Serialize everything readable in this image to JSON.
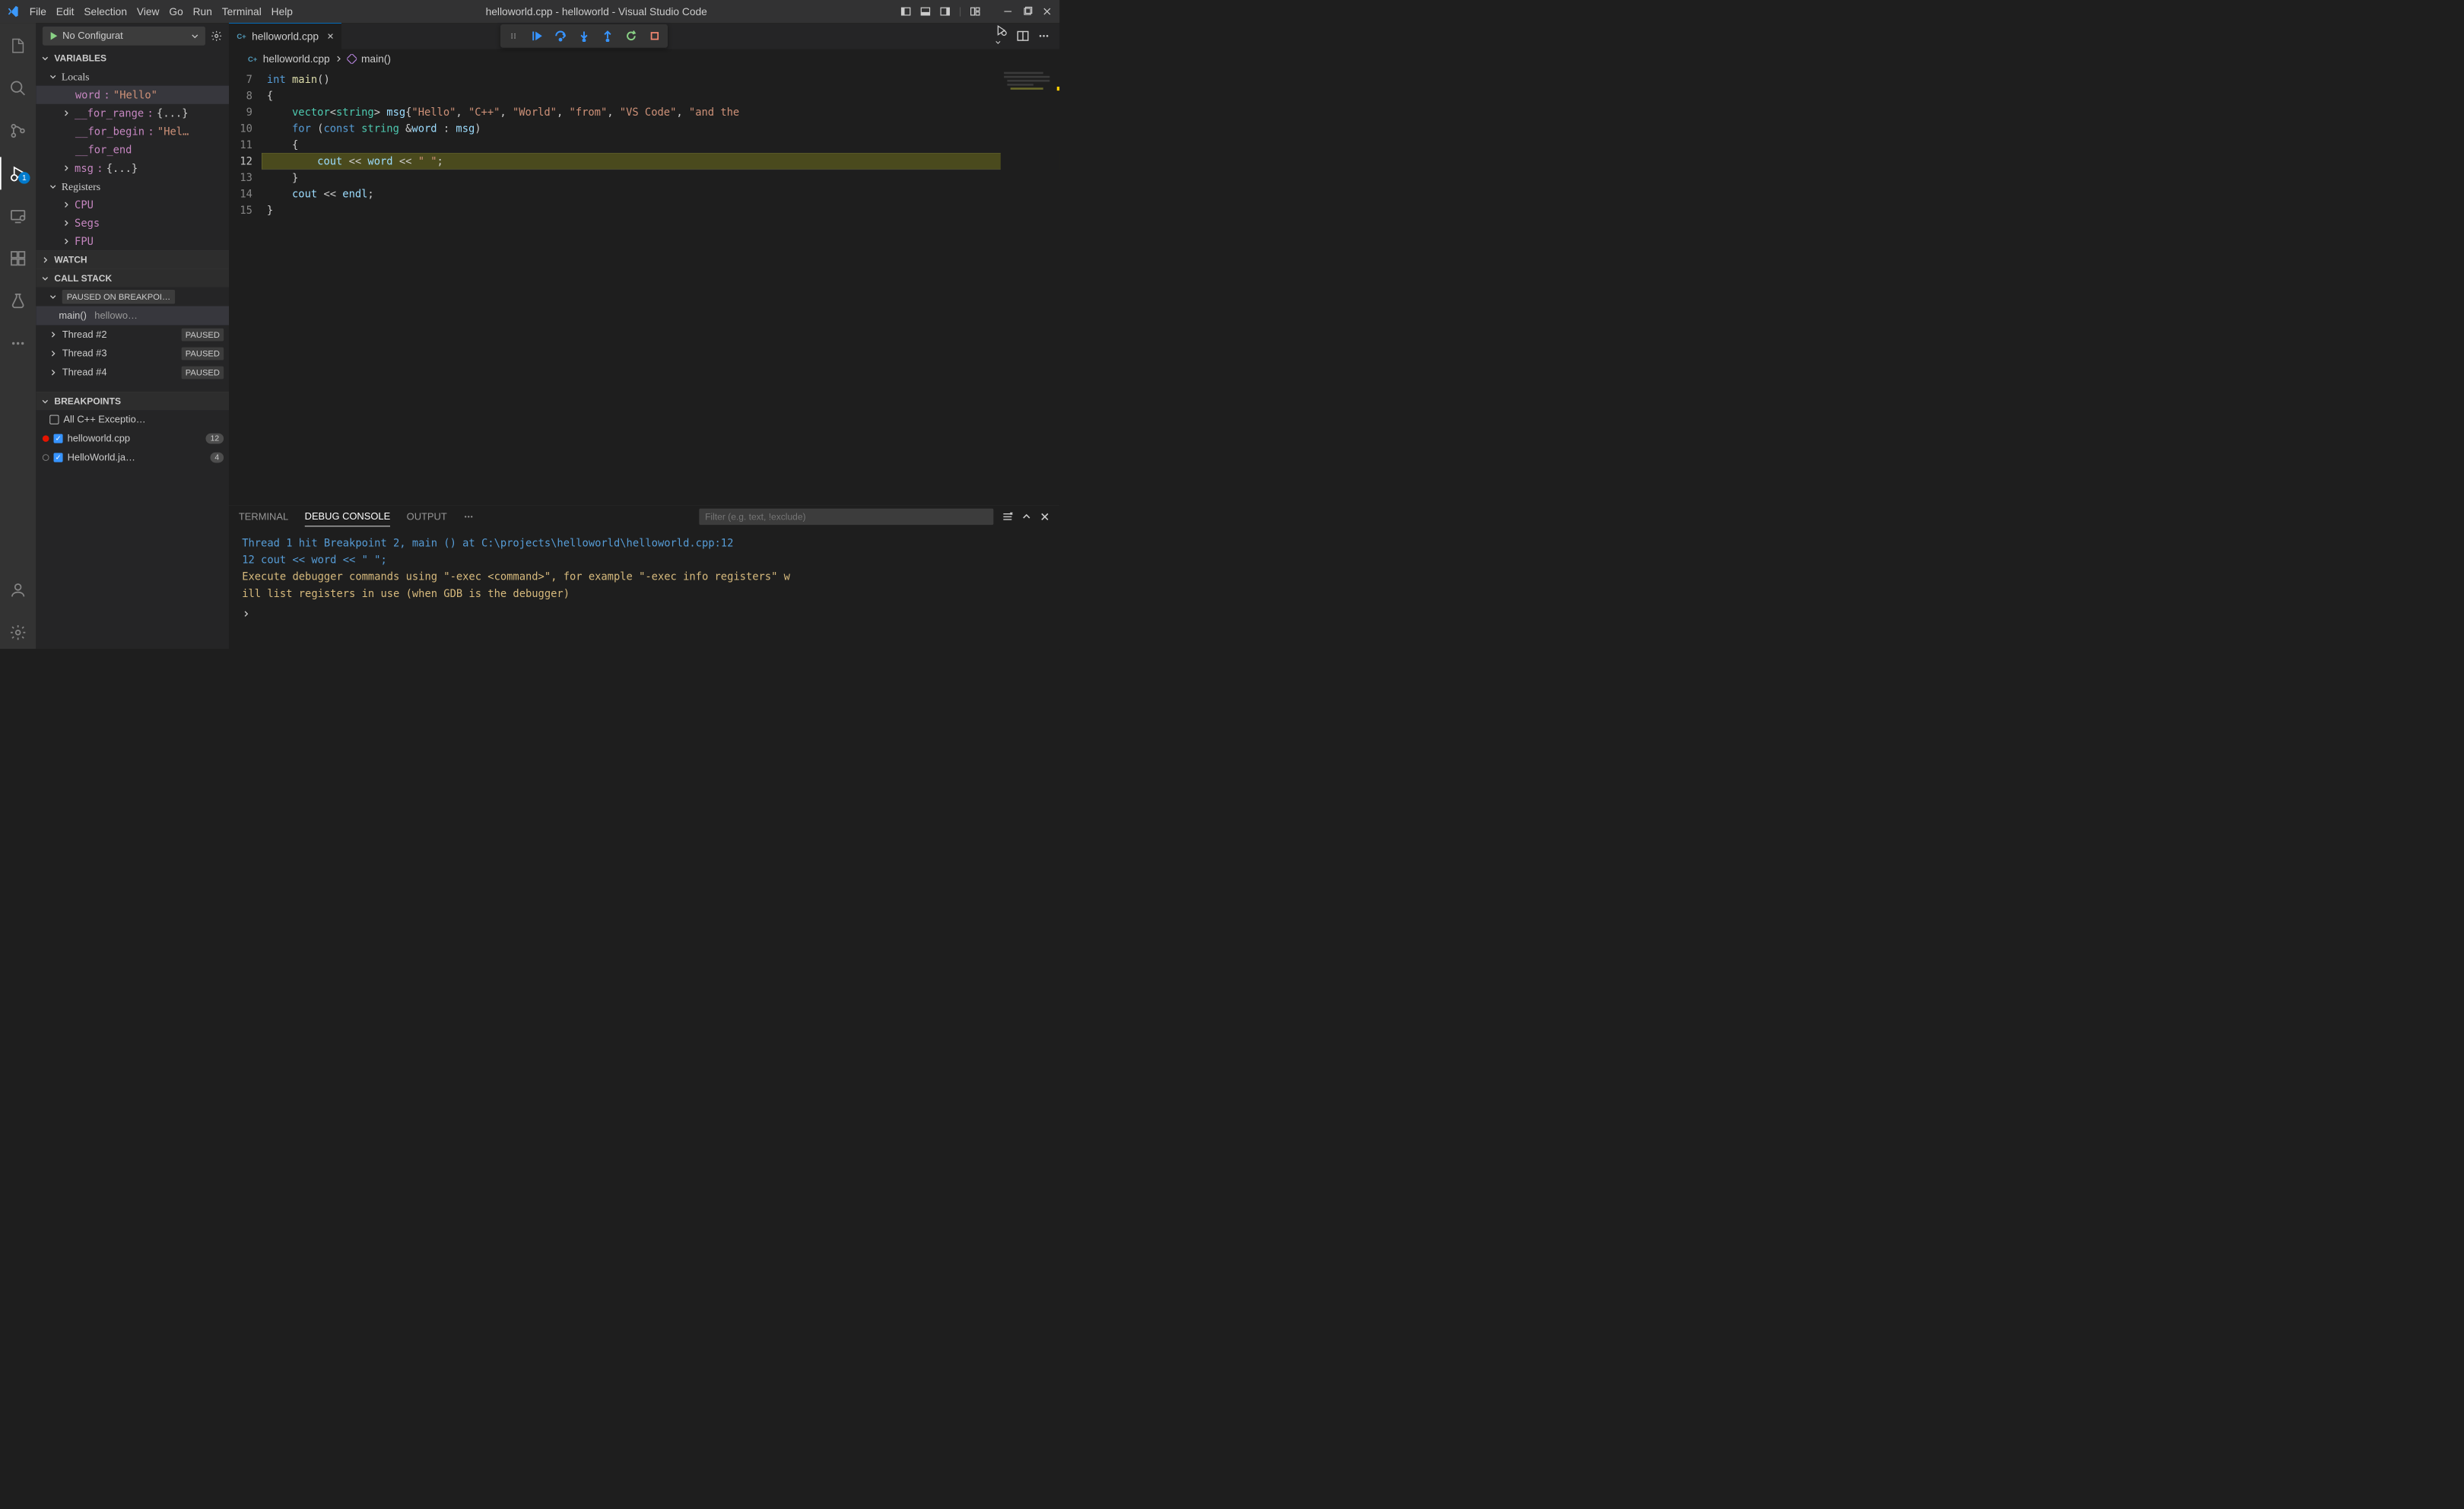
{
  "title": "helloworld.cpp - helloworld - Visual Studio Code",
  "menu": [
    "File",
    "Edit",
    "Selection",
    "View",
    "Go",
    "Run",
    "Terminal",
    "Help"
  ],
  "activity_badge": "1",
  "debug_config": {
    "label": "No Configurat"
  },
  "sections": {
    "variables": "VARIABLES",
    "locals": "Locals",
    "registers": "Registers",
    "watch": "WATCH",
    "callstack": "CALL STACK",
    "breakpoints": "BREAKPOINTS"
  },
  "locals": [
    {
      "name": "word",
      "value": "\"Hello\""
    },
    {
      "name": "__for_range",
      "value": "{...}"
    },
    {
      "name": "__for_begin",
      "value": "\"Hel…"
    },
    {
      "name": "__for_end",
      "value": ""
    },
    {
      "name": "msg",
      "value": "{...}"
    }
  ],
  "registers": [
    "CPU",
    "Segs",
    "FPU"
  ],
  "callstack": {
    "paused_banner": "PAUSED ON BREAKPOI…",
    "frame_fn": "main()",
    "frame_loc": "hellowo…",
    "threads": [
      {
        "name": "Thread #2",
        "state": "PAUSED"
      },
      {
        "name": "Thread #3",
        "state": "PAUSED"
      },
      {
        "name": "Thread #4",
        "state": "PAUSED"
      }
    ]
  },
  "breakpoints": [
    {
      "label": "All C++ Exceptio…",
      "checked": false,
      "dot": "none",
      "count": ""
    },
    {
      "label": "helloworld.cpp",
      "checked": true,
      "dot": "red",
      "count": "12"
    },
    {
      "label": "HelloWorld.ja…",
      "checked": true,
      "dot": "gray",
      "count": "4"
    }
  ],
  "tab": {
    "file": "helloworld.cpp"
  },
  "breadcrumb": {
    "file": "helloworld.cpp",
    "symbol": "main()"
  },
  "code": {
    "lines": [
      7,
      8,
      9,
      10,
      11,
      12,
      13,
      14,
      15
    ],
    "current": 12
  },
  "panel": {
    "tabs": [
      "TERMINAL",
      "DEBUG CONSOLE",
      "OUTPUT"
    ],
    "filter_placeholder": "Filter (e.g. text, !exclude)"
  },
  "console": {
    "l1": "Thread 1 hit Breakpoint 2, main () at C:\\projects\\helloworld\\helloworld.cpp:12",
    "l2a": "12",
    "l2b": "             cout << word << \" \";",
    "l3": "Execute debugger commands using \"-exec <command>\", for example \"-exec info registers\" w",
    "l4": "ill list registers in use (when GDB is the debugger)",
    "prompt": "›"
  }
}
